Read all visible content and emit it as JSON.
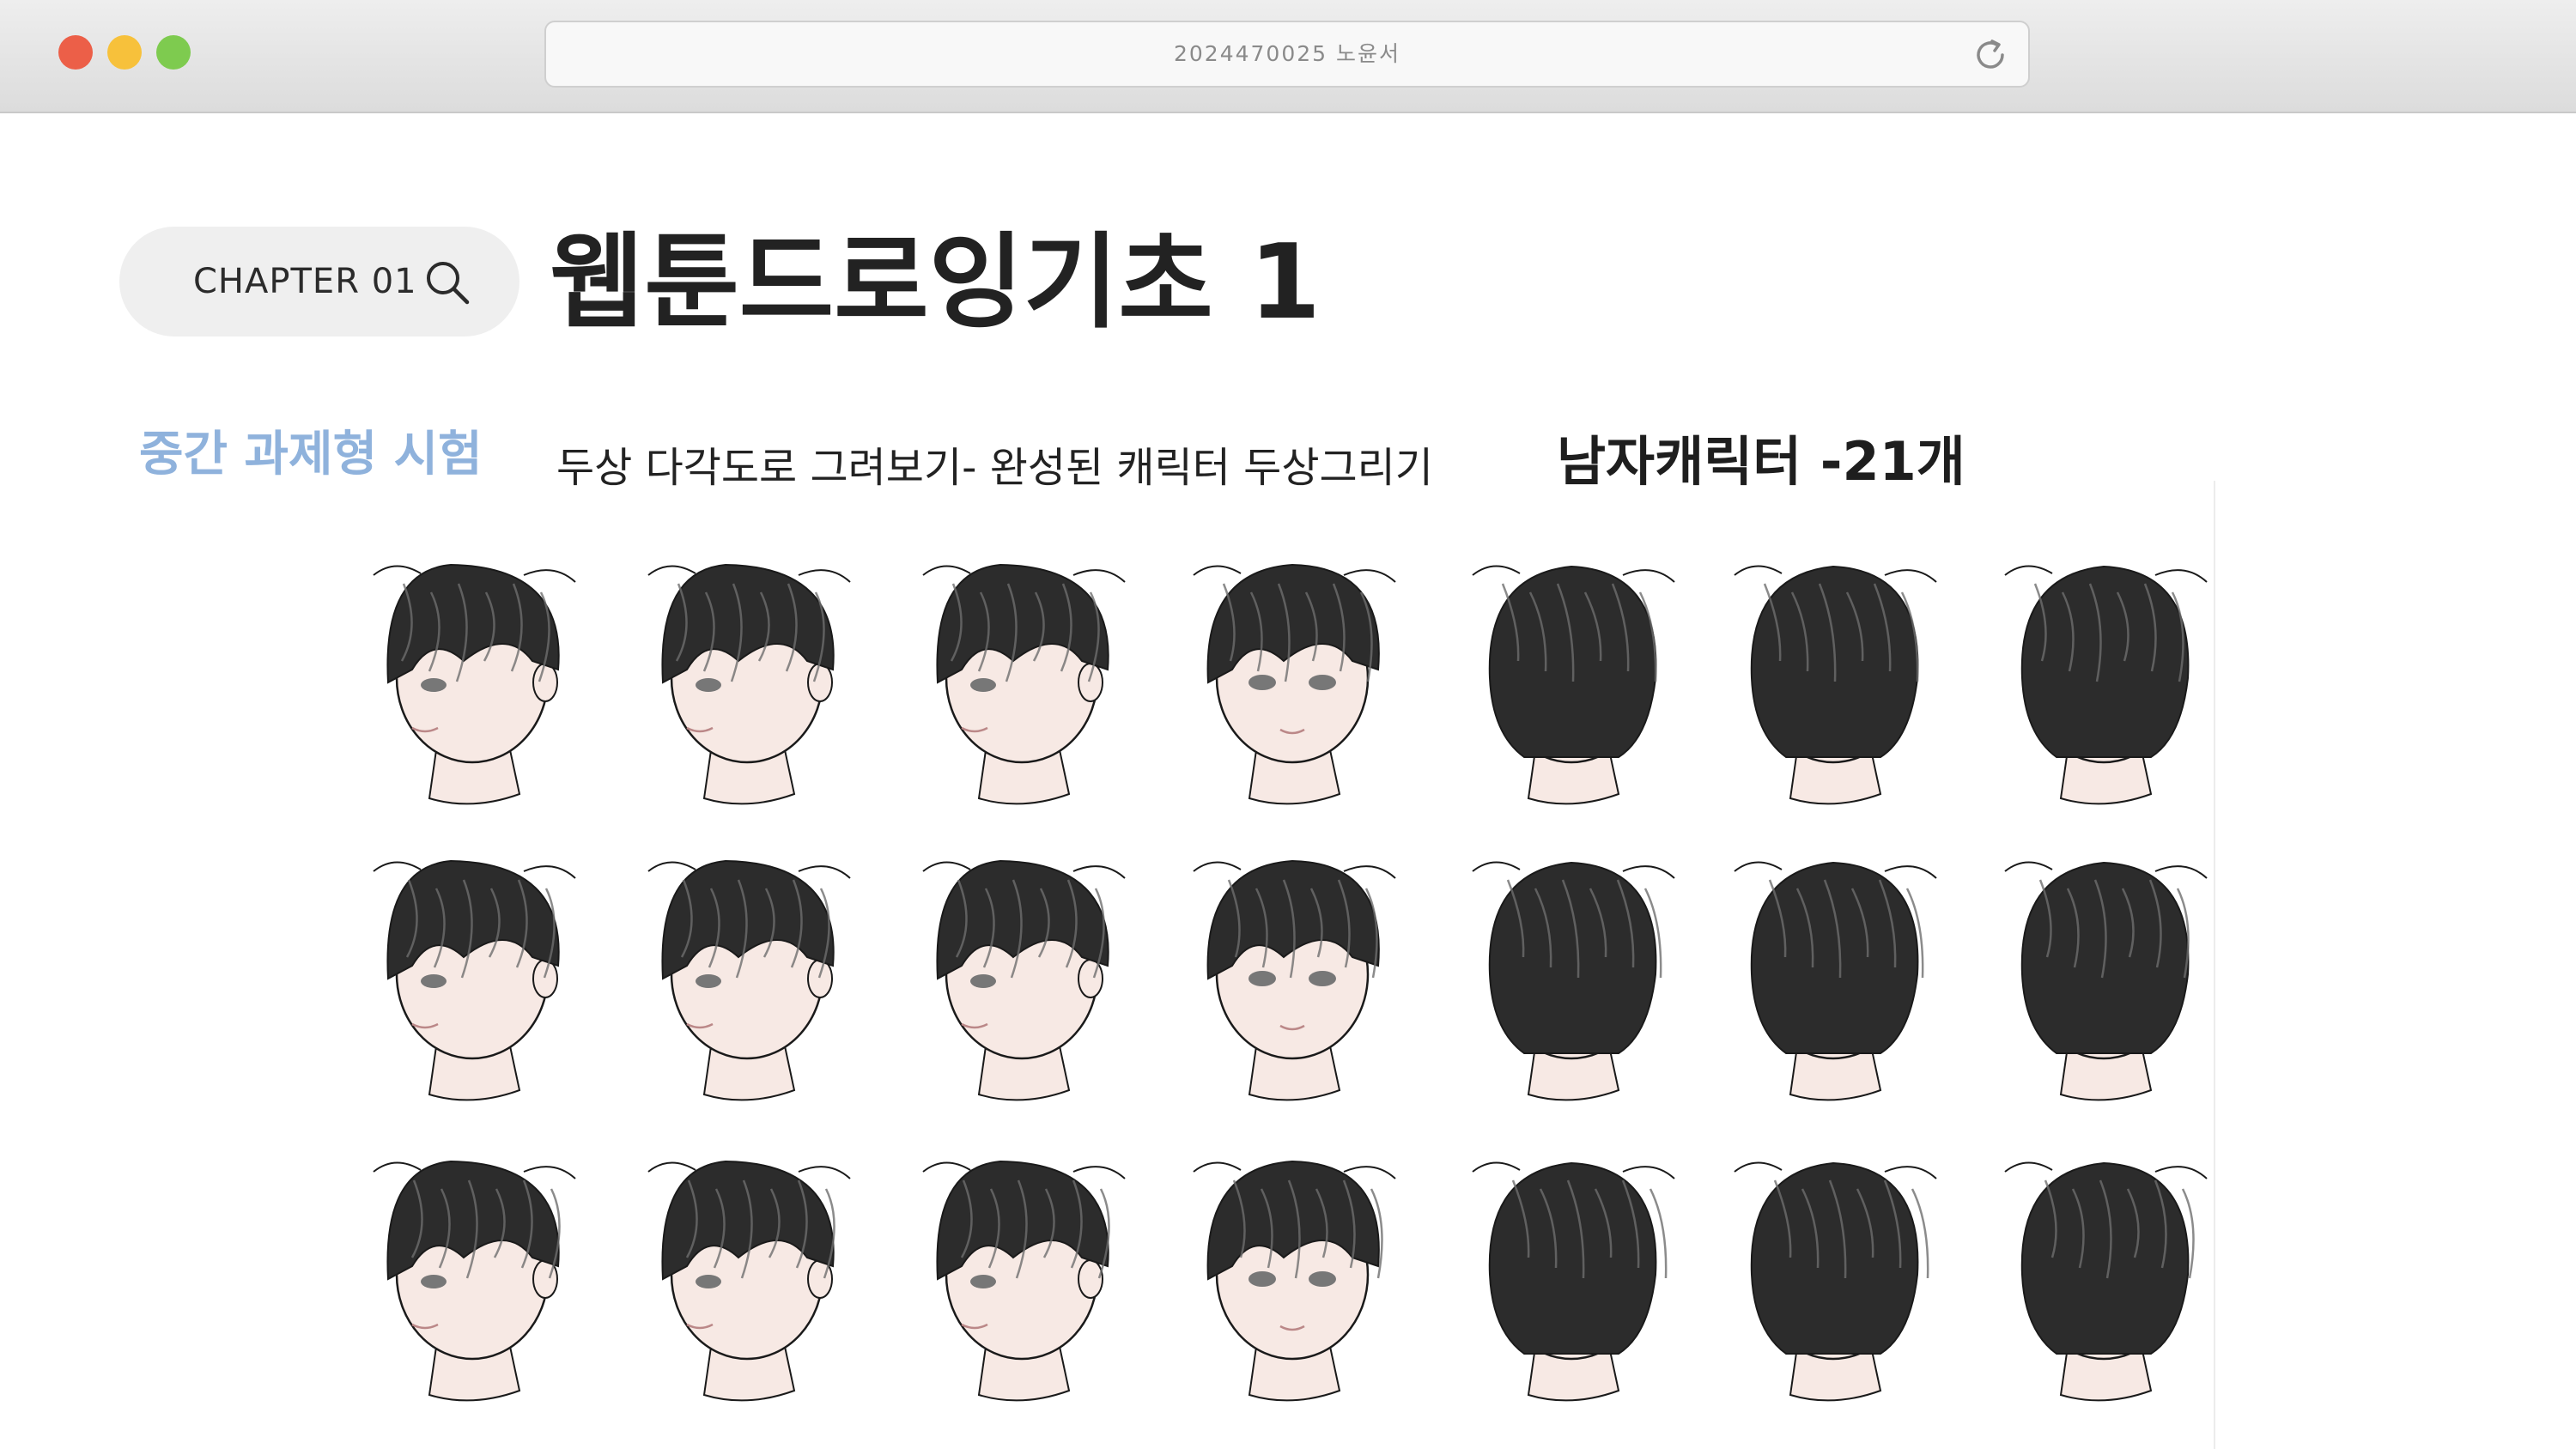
{
  "window": {
    "address": "2024470025 노윤서",
    "reload_icon": "reload-icon"
  },
  "chapter": {
    "label": "CHAPTER 01",
    "icon": "search-icon"
  },
  "page": {
    "title": "웹툰드로잉기초 1",
    "exam_label": "중간 과제형 시험",
    "task": "두상 다각도로 그려보기- 완성된 캐릭터 두상그리기",
    "count_label": "남자캐릭터 -21개"
  },
  "sketch_sheet": {
    "rows": 3,
    "columns": 7,
    "views": [
      "left-profile",
      "left-three-quarter",
      "slight-left",
      "front",
      "right-back-three-quarter",
      "back-right",
      "back"
    ],
    "hair_color": "#2c2c2c",
    "skin_color": "#f7e9e4",
    "outline_color": "#1a1a1a"
  },
  "colors": {
    "accent_blue": "#8fb2dc",
    "close": "#ec5f48",
    "minimize": "#f7c13b",
    "maximize": "#7ecb4f"
  }
}
